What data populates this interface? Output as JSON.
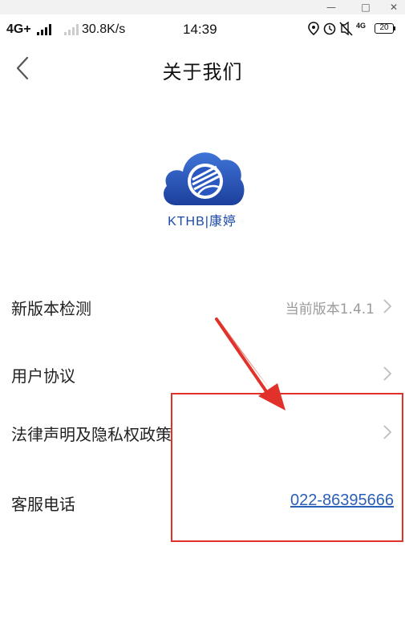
{
  "window_controls": {
    "minimize": "—",
    "maximize": "□",
    "close": "✕"
  },
  "status_bar": {
    "network": "4G+",
    "speed": "30.8K/s",
    "time": "14:39",
    "network_right": "4G",
    "battery": "20",
    "icons": [
      "location-icon",
      "alarm-icon",
      "mute-icon",
      "signal-icon"
    ]
  },
  "header": {
    "title": "关于我们"
  },
  "logo": {
    "text": "KTHB|康婷"
  },
  "settings": {
    "items": [
      {
        "label": "新版本检测",
        "value": "当前版本1.4.1"
      },
      {
        "label": "用户协议",
        "value": ""
      },
      {
        "label": "法律声明及隐私权政策",
        "value": ""
      },
      {
        "label": "客服电话",
        "value": "022-86395666"
      }
    ]
  },
  "colors": {
    "accent_link": "#2b5fb8",
    "annotation_red": "#e0322b",
    "logo_blue": "#1a4aa8"
  }
}
